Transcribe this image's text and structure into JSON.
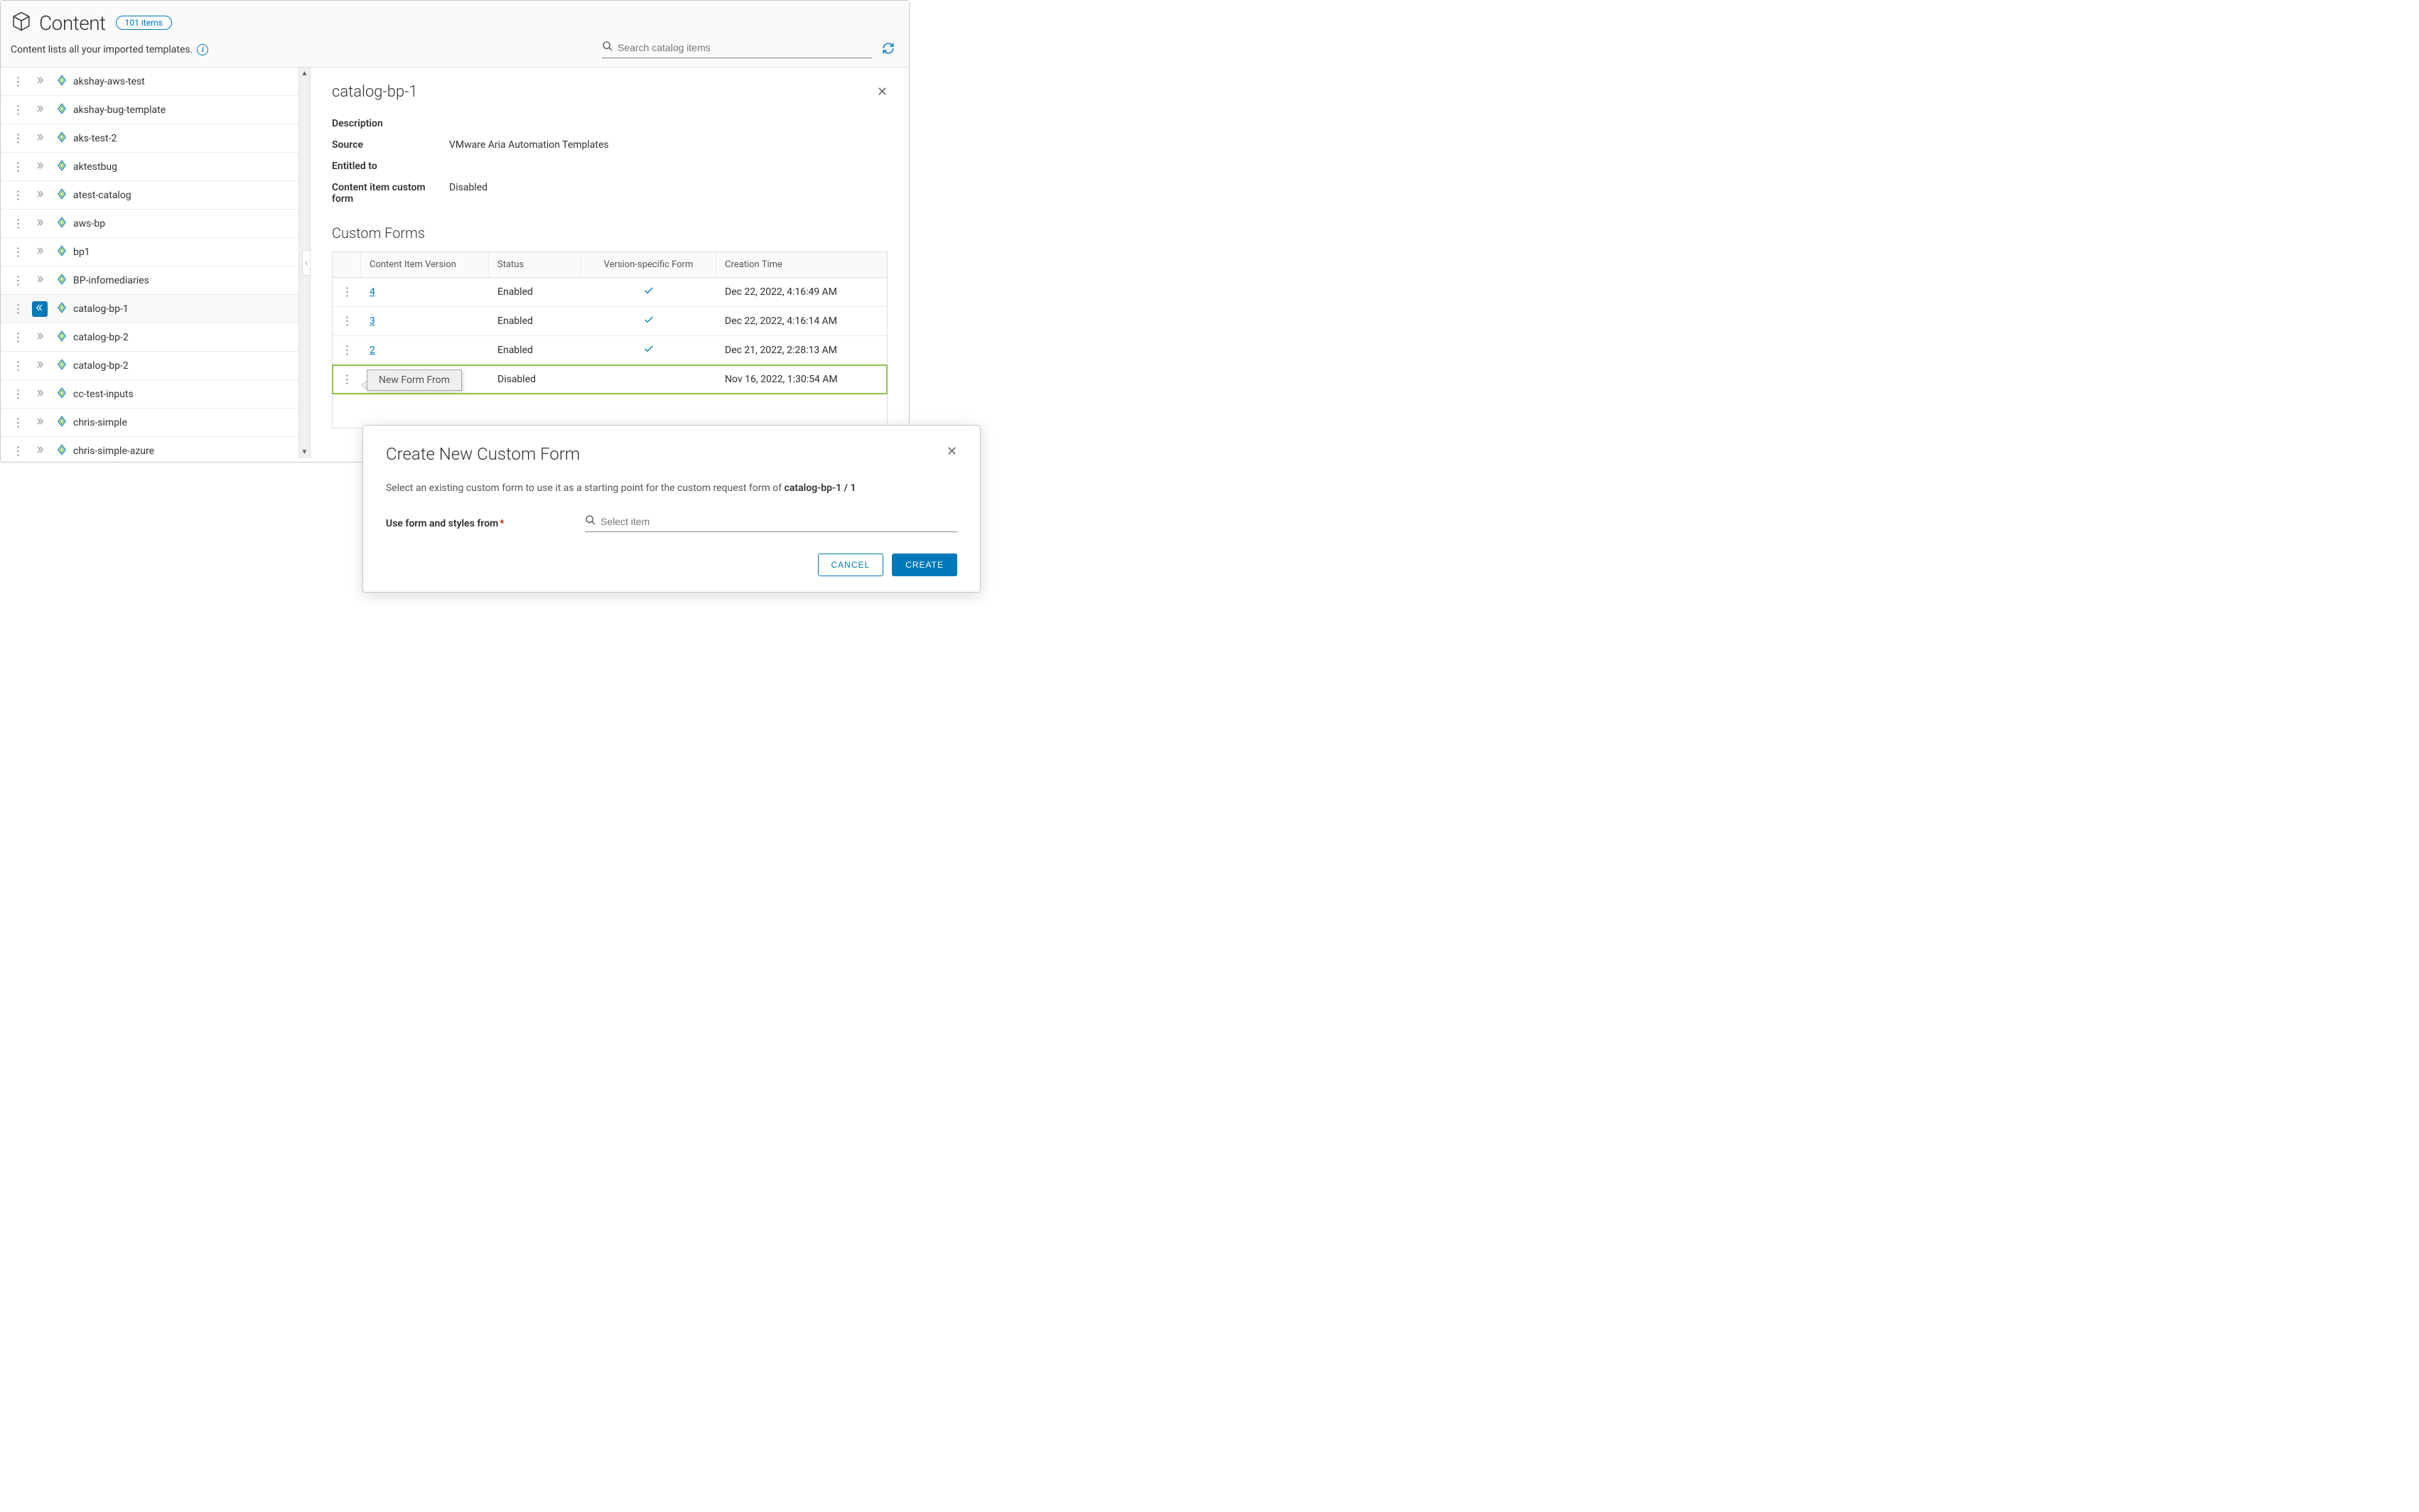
{
  "header": {
    "title": "Content",
    "badge": "101 items",
    "subtitle": "Content lists all your imported templates.",
    "search_placeholder": "Search catalog items"
  },
  "sidebar": {
    "items": [
      {
        "label": "akshay-aws-test",
        "selected": false
      },
      {
        "label": "akshay-bug-template",
        "selected": false
      },
      {
        "label": "aks-test-2",
        "selected": false
      },
      {
        "label": "aktestbug",
        "selected": false
      },
      {
        "label": "atest-catalog",
        "selected": false
      },
      {
        "label": "aws-bp",
        "selected": false
      },
      {
        "label": "bp1",
        "selected": false
      },
      {
        "label": "BP-infomediaries",
        "selected": false
      },
      {
        "label": "catalog-bp-1",
        "selected": true
      },
      {
        "label": "catalog-bp-2",
        "selected": false
      },
      {
        "label": "catalog-bp-2",
        "selected": false
      },
      {
        "label": "cc-test-inputs",
        "selected": false
      },
      {
        "label": "chris-simple",
        "selected": false
      },
      {
        "label": "chris-simple-azure",
        "selected": false
      }
    ]
  },
  "detail": {
    "title": "catalog-bp-1",
    "fields": {
      "description_label": "Description",
      "description_value": "",
      "source_label": "Source",
      "source_value": "VMware Aria Automation Templates",
      "entitled_label": "Entitled to",
      "entitled_value": "",
      "customform_label": "Content item custom form",
      "customform_value": "Disabled"
    },
    "section_title": "Custom Forms",
    "table": {
      "headers": {
        "version": "Content Item Version",
        "status": "Status",
        "vspec": "Version-specific Form",
        "time": "Creation Time"
      },
      "rows": [
        {
          "version": "4",
          "status": "Enabled",
          "vspec": true,
          "time": "Dec 22, 2022, 4:16:49 AM",
          "tooltip": null
        },
        {
          "version": "3",
          "status": "Enabled",
          "vspec": true,
          "time": "Dec 22, 2022, 4:16:14 AM",
          "tooltip": null
        },
        {
          "version": "2",
          "status": "Enabled",
          "vspec": true,
          "time": "Dec 21, 2022, 2:28:13 AM",
          "tooltip": null
        },
        {
          "version": "",
          "status": "Disabled",
          "vspec": false,
          "time": "Nov 16, 2022, 1:30:54 AM",
          "tooltip": "New Form From"
        }
      ]
    }
  },
  "modal": {
    "title": "Create New Custom Form",
    "desc_prefix": "Select an existing custom form to use it as a starting point for the custom request form of ",
    "desc_bold": "catalog-bp-1 / 1",
    "form_label": "Use form and styles from",
    "select_placeholder": "Select item",
    "cancel": "CANCEL",
    "create": "CREATE"
  }
}
